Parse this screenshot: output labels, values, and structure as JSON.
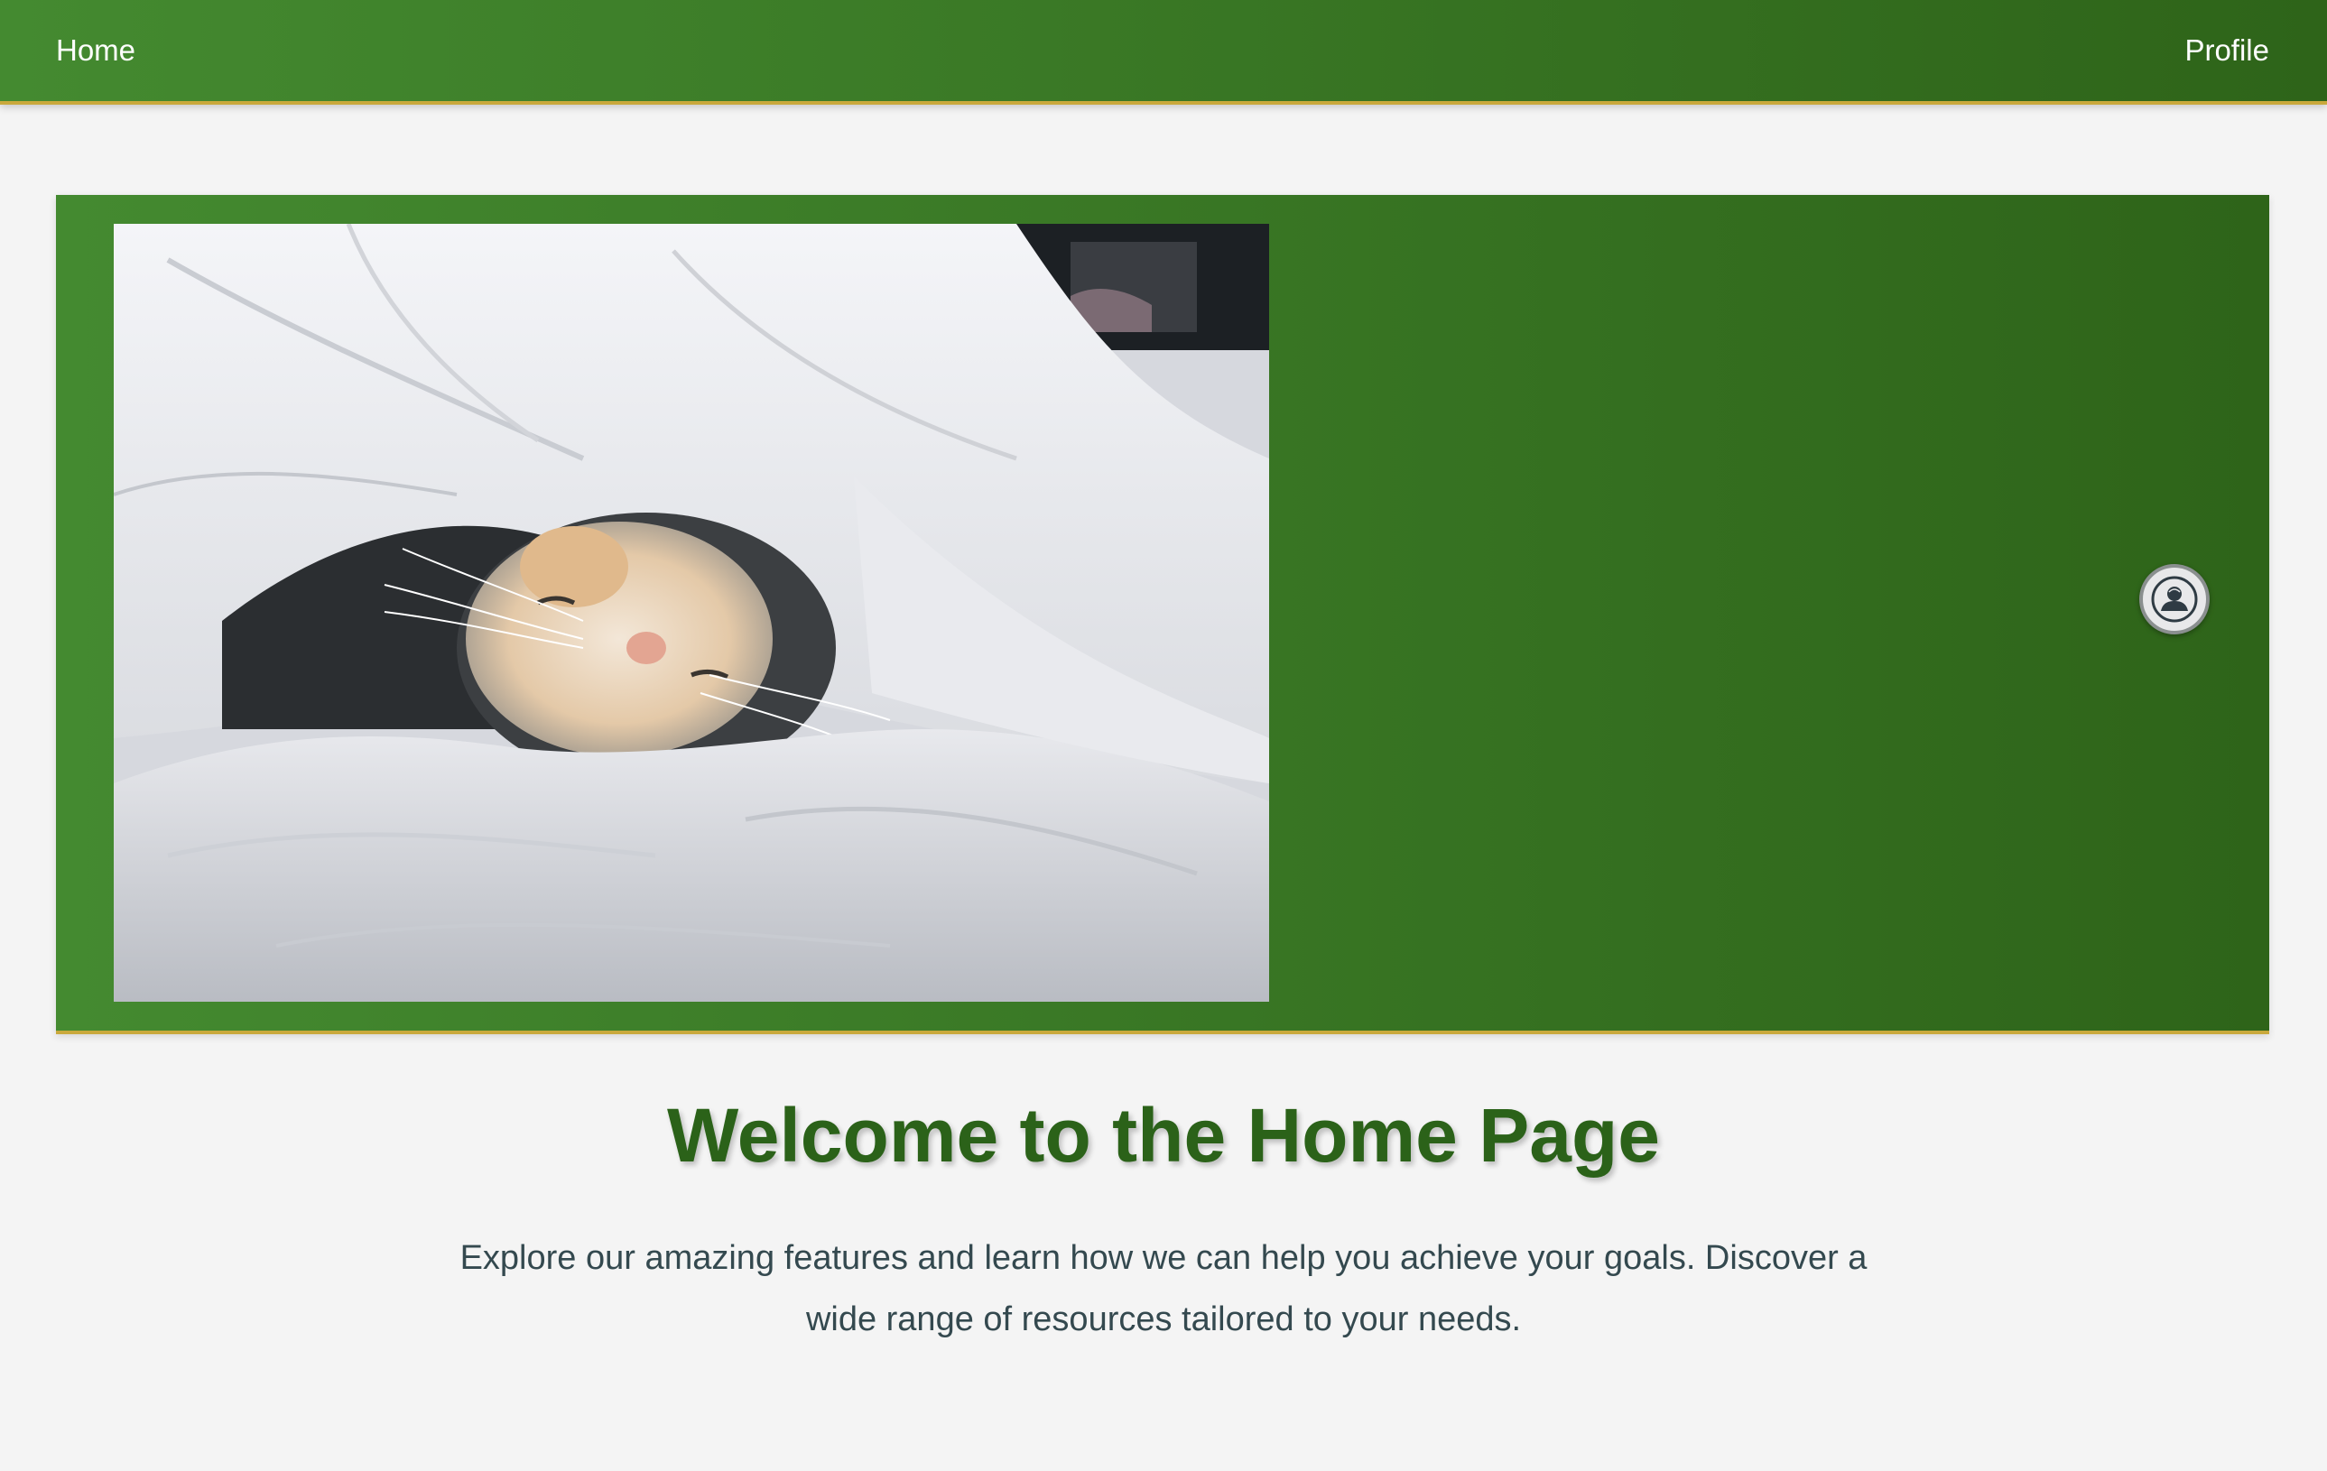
{
  "nav": {
    "home_label": "Home",
    "profile_label": "Profile"
  },
  "hero": {
    "image_alt": "Cat sleeping under a white blanket",
    "avatar_icon": "user-avatar-icon"
  },
  "main": {
    "title": "Welcome to the Home Page",
    "description": "Explore our amazing features and learn how we can help you achieve your goals. Discover a wide range of resources tailored to your needs."
  },
  "colors": {
    "accent_green_light": "#448a30",
    "accent_green_dark": "#2e6419",
    "border_gold": "#c9a93c",
    "title_green": "#2b6219",
    "body_text": "#34494f",
    "page_background": "#f4f4f4"
  }
}
